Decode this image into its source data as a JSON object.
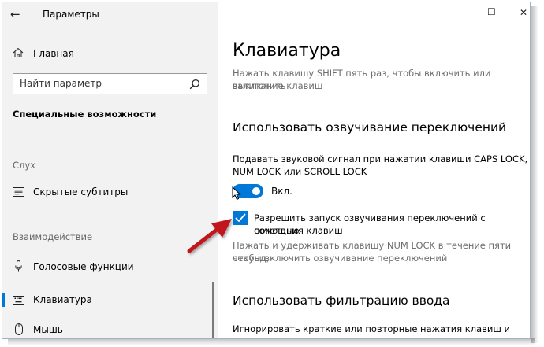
{
  "window": {
    "title": "Параметры",
    "back_icon": "←",
    "controls": {
      "minimize": "—",
      "maximize": "☐",
      "close": "✕"
    }
  },
  "sidebar": {
    "home": {
      "icon": "home-icon",
      "label": "Главная"
    },
    "search": {
      "placeholder": "Найти параметр",
      "icon": "search-icon"
    },
    "section_title": "Специальные возможности",
    "groups": [
      {
        "label": "Слух",
        "items": [
          {
            "icon": "captions-icon",
            "label": "Скрытые субтитры"
          }
        ]
      },
      {
        "label": "Взаимодействие",
        "items": [
          {
            "icon": "microphone-icon",
            "label": "Голосовые функции"
          },
          {
            "icon": "keyboard-icon",
            "label": "Клавиатура",
            "active": true
          },
          {
            "icon": "mouse-icon",
            "label": "Мышь"
          }
        ]
      }
    ]
  },
  "main": {
    "title": "Клавиатура",
    "sticky_desc_line1": "Нажать клавишу SHIFT пять раз, чтобы включить или выключить",
    "sticky_desc_line2": "залипание клавиш",
    "toggle_keys": {
      "heading": "Использовать озвучивание переключений",
      "desc_line1": "Подавать звуковой сигнал при нажатии клавиши CAPS LOCK,",
      "desc_line2": "NUM LOCK или SCROLL LOCK",
      "toggle_state": "on",
      "toggle_label": "Вкл.",
      "checkbox_checked": true,
      "checkbox_label_line1": "Разрешить запуск озвучивания переключений с помощью",
      "checkbox_label_line2": "сочетания клавиш",
      "hint_line1": "Нажать и удерживать клавишу NUM LOCK в течение пяти секунд,",
      "hint_line2": "чтобы включить озвучивание переключений"
    },
    "filter_keys": {
      "heading": "Использовать фильтрацию ввода",
      "desc_line1": "Игнорировать краткие или повторные нажатия клавиш и"
    }
  },
  "colors": {
    "accent": "#0078d7",
    "arrow": "#c0161c",
    "sidebar_bg": "#f2f2f2"
  }
}
